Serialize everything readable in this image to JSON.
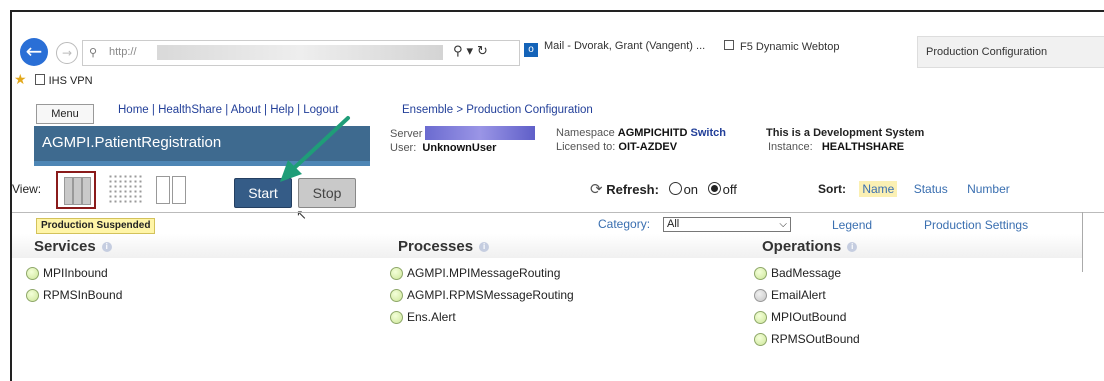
{
  "browser": {
    "url_prefix": "http://",
    "tabs": [
      {
        "label": "Mail - Dvorak, Grant (Vangent) ..."
      },
      {
        "label": "F5 Dynamic Webtop"
      },
      {
        "label": "Production Configuration"
      }
    ],
    "favorites": [
      {
        "label": "IHS VPN"
      }
    ]
  },
  "header": {
    "menu_label": "Menu",
    "links": [
      "Home",
      "HealthShare",
      "About",
      "Help",
      "Logout"
    ],
    "breadcrumb": "Ensemble > Production Configuration",
    "production_name": "AGMPI.PatientRegistration",
    "server_label": "Server",
    "user_label": "User:",
    "user_value": "UnknownUser",
    "namespace_label": "Namespace",
    "namespace_value": "AGMPICHITD",
    "switch_label": "Switch",
    "licensed_label": "Licensed to:",
    "licensed_value": "OIT-AZDEV",
    "system_note": "This is a Development System",
    "instance_label": "Instance:",
    "instance_value": "HEALTHSHARE"
  },
  "toolbar": {
    "view_label": "View:",
    "start_label": "Start",
    "stop_label": "Stop",
    "refresh_label": "Refresh:",
    "refresh_on": "on",
    "refresh_off": "off",
    "refresh_selected": "off",
    "sort_label": "Sort:",
    "sort_options": [
      "Name",
      "Status",
      "Number"
    ],
    "sort_selected": "Name"
  },
  "status": {
    "badge": "Production Suspended",
    "category_label": "Category:",
    "category_value": "All",
    "legend_label": "Legend",
    "settings_label": "Production Settings"
  },
  "columns": {
    "services": {
      "title": "Services",
      "items": [
        "MPIInbound",
        "RPMSInBound"
      ]
    },
    "processes": {
      "title": "Processes",
      "items": [
        "AGMPI.MPIMessageRouting",
        "AGMPI.RPMSMessageRouting",
        "Ens.Alert"
      ]
    },
    "operations": {
      "title": "Operations",
      "items": [
        "BadMessage",
        "EmailAlert",
        "MPIOutBound",
        "RPMSOutBound"
      ]
    }
  },
  "colors": {
    "banner": "#3e6a8f",
    "start_button": "#355c87",
    "link": "#223f99",
    "annotation_arrow": "#1f9d78"
  }
}
